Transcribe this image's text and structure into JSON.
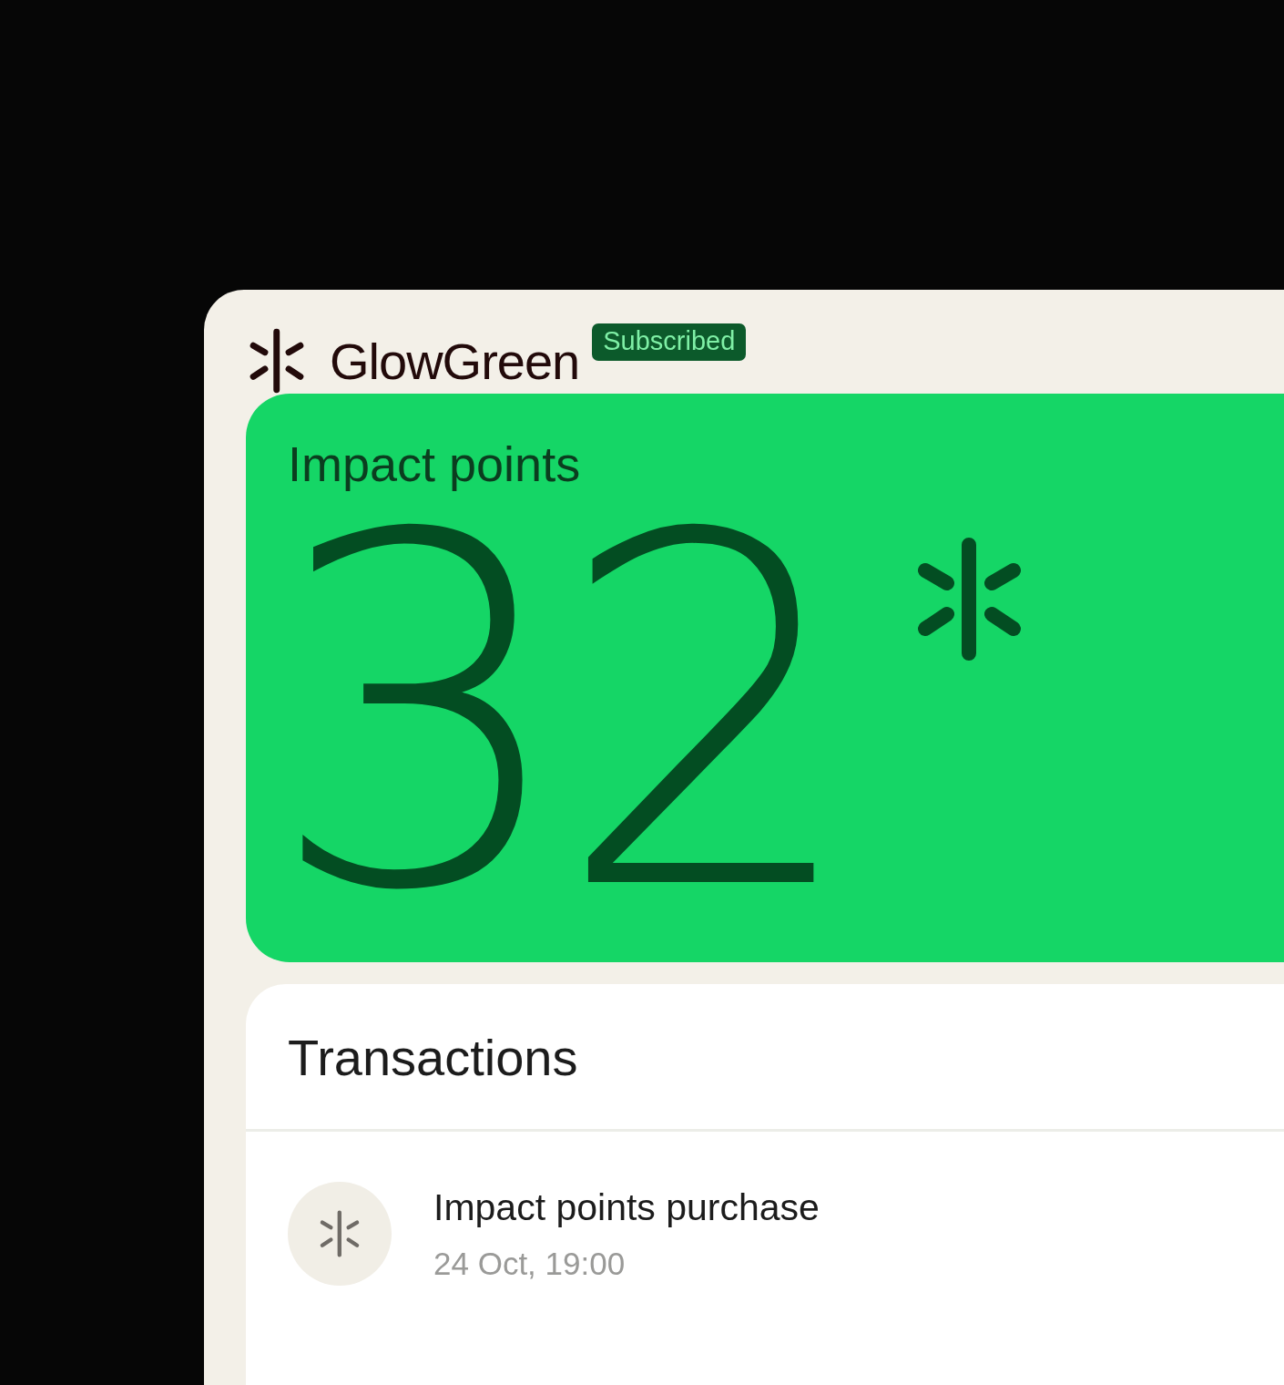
{
  "brand": {
    "name": "GlowGreen",
    "badge": "Subscribed"
  },
  "points": {
    "title": "Impact points",
    "value": "32"
  },
  "transactions": {
    "title": "Transactions",
    "items": [
      {
        "title": "Impact points purchase",
        "time": "24 Oct, 19:00"
      }
    ]
  }
}
